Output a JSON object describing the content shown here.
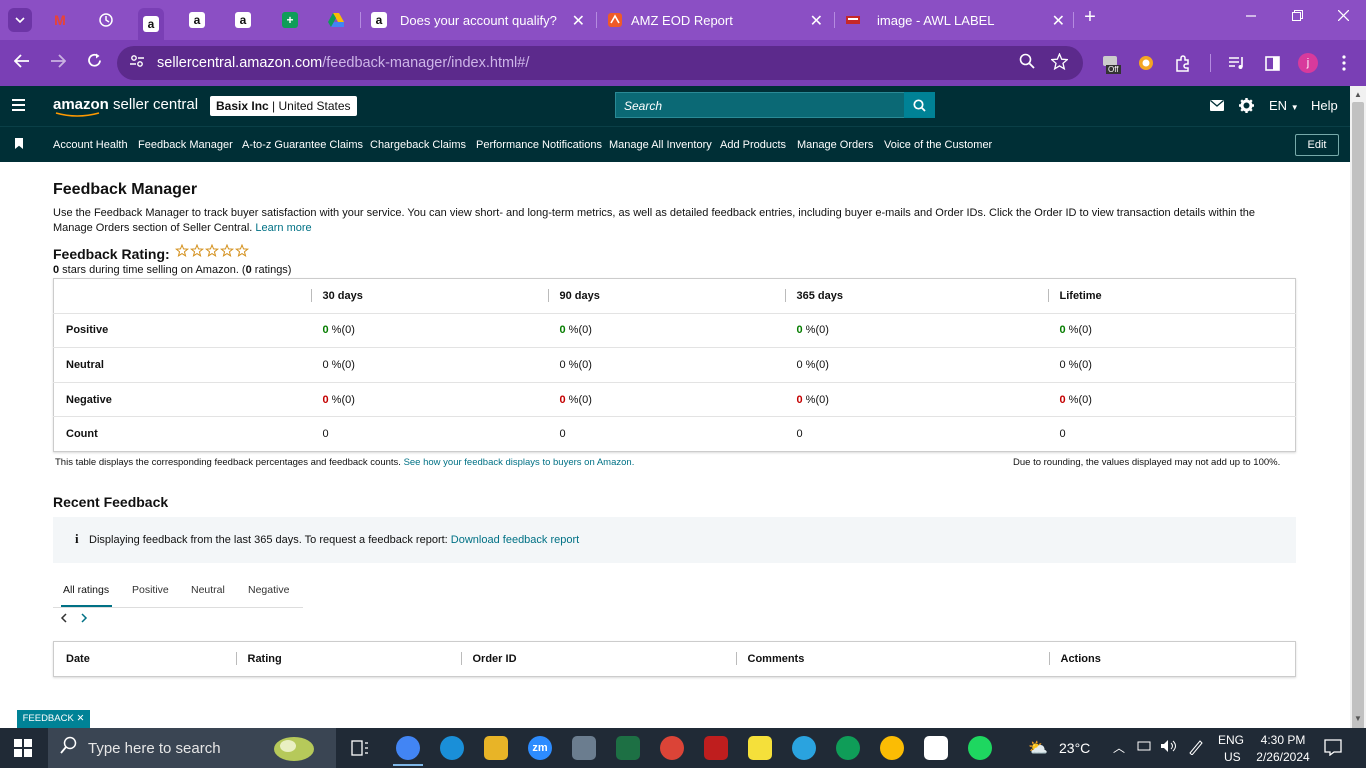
{
  "browser": {
    "tabs": [
      {
        "title": "Does your account qualify?"
      },
      {
        "title": "AMZ EOD Report"
      },
      {
        "title": "image - AWL LABEL"
      }
    ],
    "tab_close": "✕",
    "new_tab": "+",
    "url_domain": "sellercentral.amazon.com",
    "url_path": "/feedback-manager/index.html#/",
    "profile_initial": "j",
    "pinned_letter": "a",
    "ext_off_label": "Off"
  },
  "header": {
    "logo_brand": "amazon",
    "logo_product": "seller central",
    "account_name": "Basix Inc",
    "account_region": "United States",
    "search_placeholder": "Search",
    "language": "EN",
    "help": "Help"
  },
  "nav": {
    "items": [
      "Account Health",
      "Feedback Manager",
      "A-to-z Guarantee Claims",
      "Chargeback Claims",
      "Performance Notifications",
      "Manage All Inventory",
      "Add Products",
      "Manage Orders",
      "Voice of the Customer"
    ],
    "edit": "Edit"
  },
  "main": {
    "title": "Feedback Manager",
    "description": "Use the Feedback Manager to track buyer satisfaction with your service. You can view short- and long-term metrics, as well as detailed feedback entries, including buyer e-mails and Order IDs. Click the Order ID to view transaction details within the Manage Orders section of Seller Central.",
    "learn_more": "Learn more",
    "rating_title": "Feedback Rating:",
    "stars": 0,
    "rating_stars_count": "0",
    "rating_sub_mid": " stars during time selling on Amazon. (",
    "rating_count": "0",
    "rating_sub_end": " ratings)",
    "table": {
      "columns": [
        "30 days",
        "90 days",
        "365 days",
        "Lifetime"
      ],
      "rows": [
        {
          "label": "Positive",
          "values": [
            "0",
            "0",
            "0",
            "0"
          ],
          "suffix": " %(0)"
        },
        {
          "label": "Neutral",
          "values": [
            "0",
            "0",
            "0",
            "0"
          ],
          "suffix": " %(0)"
        },
        {
          "label": "Negative",
          "values": [
            "0",
            "0",
            "0",
            "0"
          ],
          "suffix": " %(0)"
        },
        {
          "label": "Count",
          "values": [
            "0",
            "0",
            "0",
            "0"
          ]
        }
      ]
    },
    "note_left": "This table displays the corresponding feedback percentages and feedback counts.",
    "note_link": "See how your feedback displays to buyers on Amazon.",
    "note_right": "Due to rounding, the values displayed may not add up to 100%.",
    "recent_title": "Recent Feedback",
    "info_text": "Displaying feedback from the last 365 days. To request a feedback report:",
    "info_link": "Download feedback report",
    "rating_tabs": [
      "All ratings",
      "Positive",
      "Neutral",
      "Negative"
    ],
    "recent_columns": [
      "Date",
      "Rating",
      "Order ID",
      "Comments",
      "Actions"
    ],
    "feedback_tag": "FEEDBACK ✕"
  },
  "taskbar": {
    "search_placeholder": "Type here to search",
    "weather": "23°C",
    "lang": "ENG",
    "region": "US",
    "time": "4:30 PM",
    "date": "2/26/2024",
    "zoom_label": "zm"
  },
  "colors": {
    "header_bg": "#002f36",
    "tab_bar": "#8b4fc4",
    "link": "#007185",
    "positive": "#067d00",
    "negative": "#c40000"
  }
}
